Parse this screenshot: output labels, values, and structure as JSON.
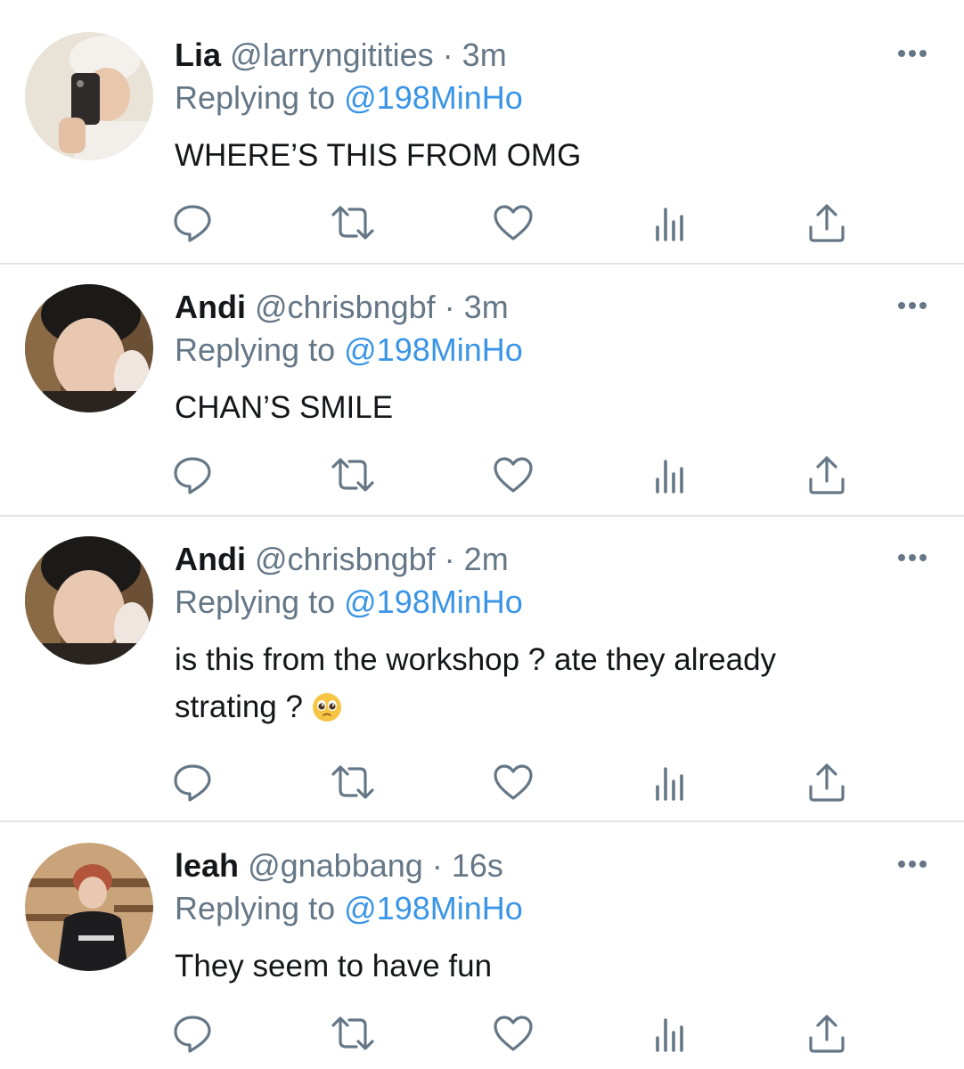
{
  "reply_prefix": "Replying to",
  "colors": {
    "accent": "#3a95e6",
    "muted": "#657786",
    "text": "#14171a",
    "divider": "#e1e4e8"
  },
  "icons": [
    "reply-icon",
    "retweet-icon",
    "like-icon",
    "analytics-icon",
    "share-icon",
    "more-icon"
  ],
  "tweets": [
    {
      "name": "Lia",
      "handle": "@larryngitities",
      "sep": "·",
      "time": "3m",
      "reply_to": "@198MinHo",
      "text": "WHERE’S THIS FROM OMG",
      "emoji": ""
    },
    {
      "name": "Andi",
      "handle": "@chrisbngbf",
      "sep": "·",
      "time": "3m",
      "reply_to": "@198MinHo",
      "text": "CHAN’S SMILE",
      "emoji": ""
    },
    {
      "name": "Andi",
      "handle": "@chrisbngbf",
      "sep": "·",
      "time": "2m",
      "reply_to": "@198MinHo",
      "text": "is this from the workshop ? ate they already strating ?",
      "emoji": "pleading-face"
    },
    {
      "name": "leah",
      "handle": "@gnabbang",
      "sep": "·",
      "time": "16s",
      "reply_to": "@198MinHo",
      "text": "They seem to have fun",
      "emoji": ""
    }
  ]
}
